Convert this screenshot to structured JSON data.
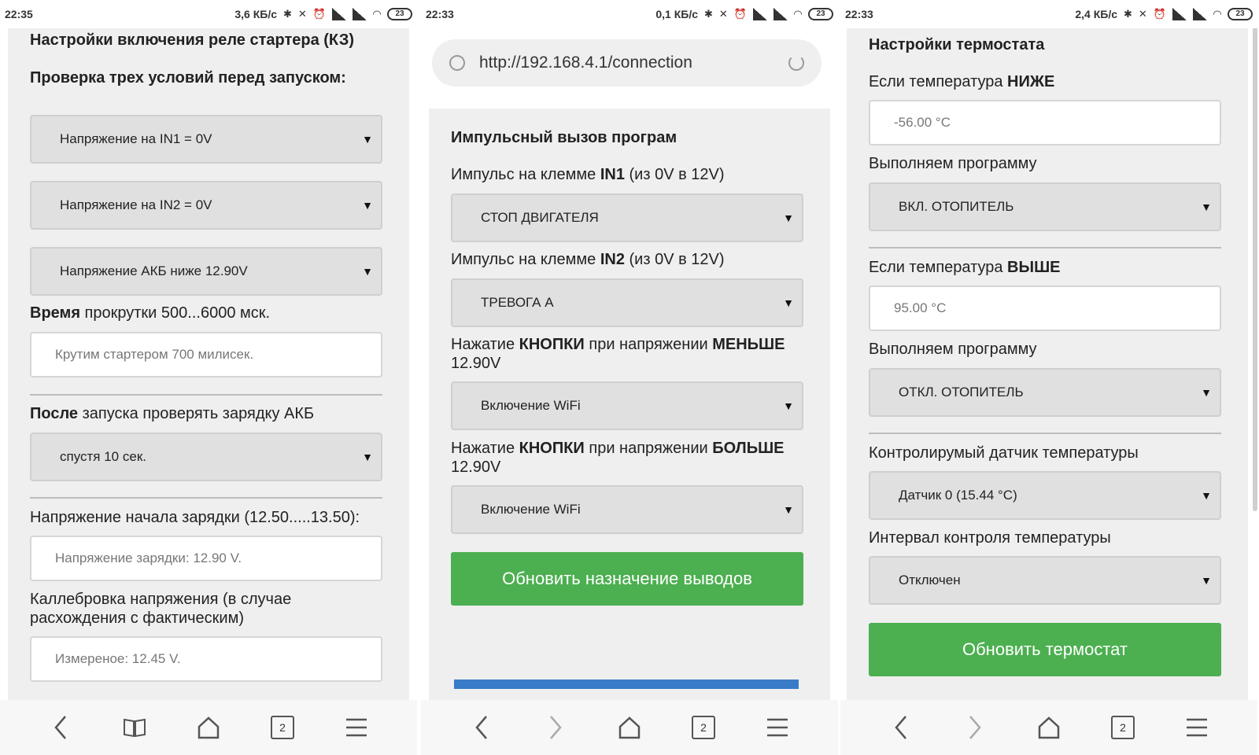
{
  "screen1": {
    "status": {
      "time": "22:35",
      "net": "3,6 КБ/с",
      "battery": "23"
    },
    "title": "Настройки включения реле стартера (КЗ)",
    "check_heading": "Проверка трех условий перед запуском:",
    "cond1": "Напряжение на IN1 = 0V",
    "cond2": "Напряжение на IN2 = 0V",
    "cond3": "Напряжение АКБ ниже 12.90V",
    "crank_label_bold": "Время",
    "crank_label_rest": " прокрутки 500...6000 мск.",
    "crank_value": "Крутим стартером 700 милисек.",
    "after_label_bold": "После",
    "after_label_rest": " запуска проверять зарядку АКБ",
    "after_value": "спустя 10 сек.",
    "charge_label": "Напряжение начала зарядки (12.50.....13.50):",
    "charge_value": "Напряжение зарядки: 12.90 V.",
    "calib_label": "Каллебровка напряжения (в случае расхождения с фактическим)",
    "calib_value": "Измереное: 12.45 V.",
    "tab_count": "2"
  },
  "screen2": {
    "status": {
      "time": "22:33",
      "net": "0,1 КБ/с",
      "battery": "23"
    },
    "url": "http://192.168.4.1/connection",
    "title": "Импульсный вызов програм",
    "in1_label_pre": "Импульс на клемме ",
    "in1_label_bold": "IN1",
    "in1_label_post": " (из 0V в 12V)",
    "in1_value": "СТОП ДВИГАТЕЛЯ",
    "in2_label_pre": "Импульс на клемме ",
    "in2_label_bold": "IN2",
    "in2_label_post": " (из 0V в 12V)",
    "in2_value": "ТРЕВОГА А",
    "less_pre": "Нажатие ",
    "less_bold1": "КНОПКИ",
    "less_mid": " при напряжении ",
    "less_bold2": "МЕНЬШЕ",
    "less_post": " 12.90V",
    "less_value": "Включение WiFi",
    "more_pre": "Нажатие ",
    "more_bold1": "КНОПКИ",
    "more_mid": " при напряжении ",
    "more_bold2": "БОЛЬШЕ",
    "more_post": " 12.90V",
    "more_value": "Включение WiFi",
    "button": "Обновить назначение выводов",
    "tab_count": "2"
  },
  "screen3": {
    "status": {
      "time": "22:33",
      "net": "2,4 КБ/с",
      "battery": "23"
    },
    "title": "Настройки термостата",
    "low_pre": "Если температура ",
    "low_bold": "НИЖЕ",
    "low_value": "-56.00 °C",
    "prog1_label": "Выполняем программу",
    "prog1_value": "ВКЛ. ОТОПИТЕЛЬ",
    "high_pre": "Если температура ",
    "high_bold": "ВЫШЕ",
    "high_value": "95.00 °C",
    "prog2_label": "Выполняем программу",
    "prog2_value": "ОТКЛ. ОТОПИТЕЛЬ",
    "sensor_label": "Контролирумый датчик температуры",
    "sensor_value": "Датчик 0 (15.44 °C)",
    "interval_label": "Интервал контроля температуры",
    "interval_value": "Отключен",
    "button": "Обновить термостат",
    "tab_count": "2"
  },
  "icons": {
    "dropdown_arrow": "▼",
    "status_icons": "✱ ✕ ⏰"
  }
}
